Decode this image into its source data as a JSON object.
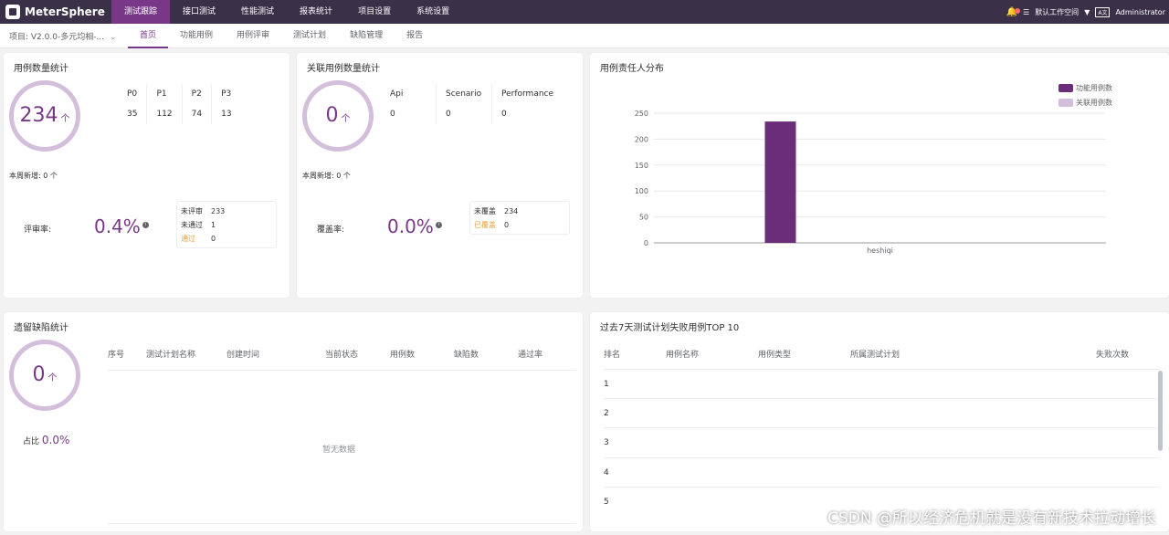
{
  "app": {
    "name": "MeterSphere"
  },
  "topnav": [
    "测试跟踪",
    "接口测试",
    "性能测试",
    "报表统计",
    "项目设置",
    "系统设置"
  ],
  "topbar_right": {
    "workspace": "默认工作空间",
    "lang": "A文",
    "user": "Administrator"
  },
  "project": {
    "label": "项目: V2.0.0-多元均相-..."
  },
  "subnav": [
    "首页",
    "功能用例",
    "用例评审",
    "测试计划",
    "缺陷管理",
    "报告"
  ],
  "case_stats": {
    "title": "用例数量统计",
    "total": "234",
    "unit": "个",
    "cols": [
      {
        "h": "P0",
        "v": "35"
      },
      {
        "h": "P1",
        "v": "112"
      },
      {
        "h": "P2",
        "v": "74"
      },
      {
        "h": "P3",
        "v": "13"
      }
    ],
    "new_week_label": "本周新增:",
    "new_week_value": "0 个",
    "rate_label": "评审率:",
    "rate_value": "0.4%",
    "box": [
      {
        "k": "未评审",
        "v": "233"
      },
      {
        "k": "未通过",
        "v": "1"
      },
      {
        "k": "通过",
        "v": "0"
      }
    ]
  },
  "related_stats": {
    "title": "关联用例数量统计",
    "total": "0",
    "unit": "个",
    "cols": [
      {
        "h": "Api",
        "v": "0"
      },
      {
        "h": "Scenario",
        "v": "0"
      },
      {
        "h": "Performance",
        "v": "0"
      }
    ],
    "new_week_label": "本周新增:",
    "new_week_value": "0 个",
    "rate_label": "覆盖率:",
    "rate_value": "0.0%",
    "box": [
      {
        "k": "未覆盖",
        "v": "234"
      },
      {
        "k": "已覆盖",
        "v": "0"
      }
    ]
  },
  "owner_chart": {
    "title": "用例责任人分布"
  },
  "chart_data": {
    "type": "bar",
    "categories": [
      "heshiqi"
    ],
    "series": [
      {
        "name": "功能用例数",
        "values": [
          234
        ],
        "color": "#6b2c7a"
      },
      {
        "name": "关联用例数",
        "values": [
          0
        ],
        "color": "#d3bedb"
      }
    ],
    "yticks": [
      "250",
      "200",
      "150",
      "100",
      "50",
      "0"
    ],
    "ylim": [
      0,
      250
    ],
    "grid": true,
    "legend": "top-right"
  },
  "defect_stats": {
    "title": "遗留缺陷统计",
    "total": "0",
    "unit": "个",
    "ratio_label": "占比",
    "ratio_value": "0.0%",
    "columns": [
      "序号",
      "测试计划名称",
      "创建时间",
      "当前状态",
      "用例数",
      "缺陷数",
      "通过率"
    ],
    "empty": "暂无数据"
  },
  "top10": {
    "title": "过去7天测试计划失败用例TOP 10",
    "columns": [
      "排名",
      "用例名称",
      "用例类型",
      "所属测试计划",
      "失败次数"
    ],
    "rows": [
      "1",
      "2",
      "3",
      "4",
      "5"
    ]
  },
  "watermark": "CSDN @所以经济危机就是没有新技术拉动增长"
}
